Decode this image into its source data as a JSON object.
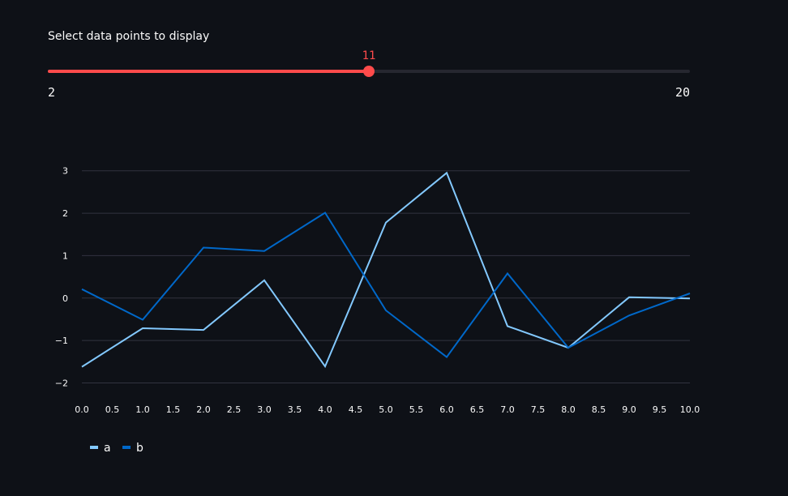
{
  "slider": {
    "label": "Select data points to display",
    "min": 2,
    "max": 20,
    "value": 11,
    "min_label": "2",
    "max_label": "20",
    "value_label": "11",
    "accent_color": "#ff4b4b",
    "track_color": "#262730"
  },
  "chart_data": {
    "type": "line",
    "title": "",
    "xlabel": "",
    "ylabel": "",
    "x": [
      0,
      1,
      2,
      3,
      4,
      5,
      6,
      7,
      8,
      9,
      10
    ],
    "xlim": [
      0,
      10
    ],
    "ylim": [
      -2.2,
      3.3
    ],
    "x_ticks": [
      "0.0",
      "0.5",
      "1.0",
      "1.5",
      "2.0",
      "2.5",
      "3.0",
      "3.5",
      "4.0",
      "4.5",
      "5.0",
      "5.5",
      "6.0",
      "6.5",
      "7.0",
      "7.5",
      "8.0",
      "8.5",
      "9.0",
      "9.5",
      "10.0"
    ],
    "y_ticks": [
      3,
      2,
      1,
      0,
      -1,
      -2
    ],
    "y_tick_labels": [
      "3",
      "2",
      "1",
      "0",
      "−1",
      "−2"
    ],
    "grid": "horizontal",
    "legend_position": "bottom-left",
    "series": [
      {
        "name": "a",
        "color": "#83c9ff",
        "values": [
          -1.62,
          -0.71,
          -0.75,
          0.42,
          -1.61,
          1.78,
          2.95,
          -0.66,
          -1.17,
          0.02,
          -0.01
        ]
      },
      {
        "name": "b",
        "color": "#0068c9",
        "values": [
          0.21,
          -0.51,
          1.19,
          1.11,
          2.01,
          -0.29,
          -1.39,
          0.58,
          -1.17,
          -0.41,
          0.11
        ]
      }
    ]
  }
}
